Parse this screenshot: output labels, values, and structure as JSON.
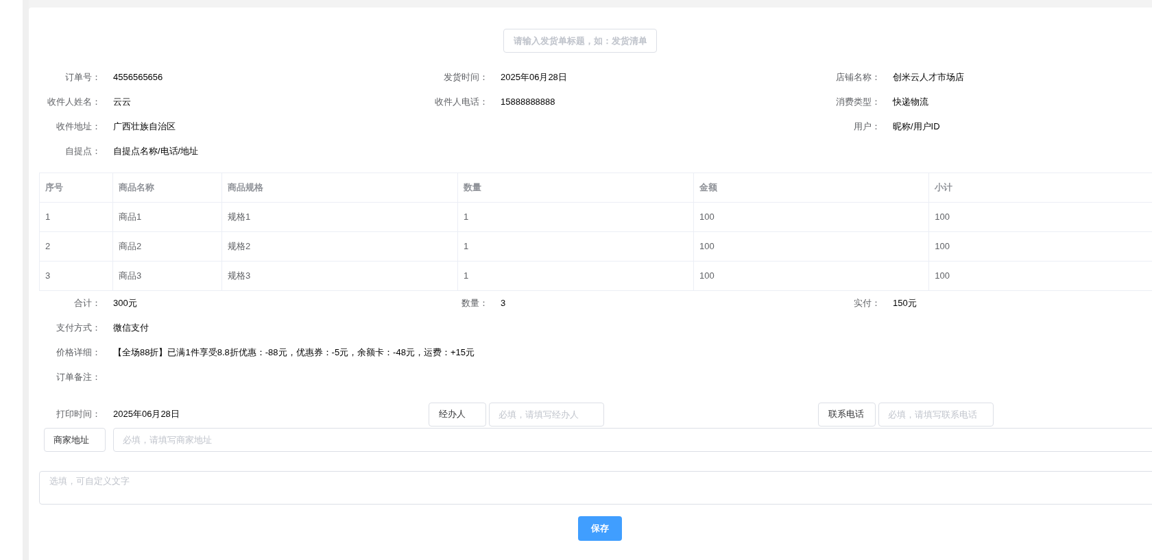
{
  "title_input": {
    "placeholder": "请输入发货单标题，如：发货清单"
  },
  "info_columns": [
    [
      {
        "label": "订单号：",
        "value": "4556565656"
      },
      {
        "label": "收件人姓名：",
        "value": "云云"
      },
      {
        "label": "收件地址：",
        "value": "广西壮族自治区"
      },
      {
        "label": "自提点：",
        "value": "自提点名称/电话/地址"
      }
    ],
    [
      {
        "label": "发货时间：",
        "value": "2025年06月28日"
      },
      {
        "label": "收件人电话：",
        "value": "15888888888"
      }
    ],
    [
      {
        "label": "店铺名称：",
        "value": "创米云人才市场店"
      },
      {
        "label": "消费类型：",
        "value": "快递物流"
      },
      {
        "label": "用户：",
        "value": "昵称/用户ID"
      }
    ]
  ],
  "table": {
    "columns": [
      "序号",
      "商品名称",
      "商品规格",
      "数量",
      "金额",
      "小计"
    ],
    "rows": [
      [
        "1",
        "商品1",
        "规格1",
        "1",
        "100",
        "100"
      ],
      [
        "2",
        "商品2",
        "规格2",
        "1",
        "100",
        "100"
      ],
      [
        "3",
        "商品3",
        "规格3",
        "1",
        "100",
        "100"
      ]
    ]
  },
  "totals": [
    {
      "label": "合计：",
      "value": "300元"
    },
    {
      "label": "数量：",
      "value": "3"
    },
    {
      "label": "实付：",
      "value": "150元"
    }
  ],
  "details": [
    {
      "label": "支付方式：",
      "value": "微信支付"
    },
    {
      "label": "价格详细：",
      "value": "【全场88折】已满1件享受8.8折优惠：-88元，优惠券：-5元，余额卡：-48元，运费：+15元"
    },
    {
      "label": "订单备注："
    }
  ],
  "print_time": {
    "label": "打印时间：",
    "value": "2025年06月28日"
  },
  "handler": {
    "button": "经办人",
    "placeholder": "必填，请填写经办人"
  },
  "contact_phone": {
    "button": "联系电话",
    "placeholder": "必填，请填写联系电话"
  },
  "merchant_address": {
    "button": "商家地址",
    "placeholder": "必填，请填写商家地址"
  },
  "remark": {
    "placeholder": "选填，可自定义文字"
  },
  "save_button": "保存"
}
